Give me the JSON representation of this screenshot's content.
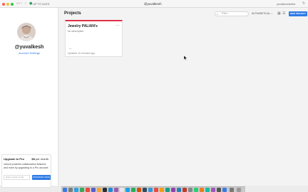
{
  "browser": {
    "tab_label": "UP TO DATE",
    "url": "@yuvalkesh",
    "account_label": "yuvalkesherlier"
  },
  "sidebar": {
    "username": "@yuvalkesh",
    "account_link": "Account Settings"
  },
  "upgrade": {
    "title": "Upgrade to Pro",
    "price": "$8",
    "price_period": "per month",
    "description": "Unlock powerful collaboration features and more by upgrading to a Pro account",
    "input_placeholder": "Enter coupon code",
    "button_label": "UPGRADE ONCE"
  },
  "main": {
    "title": "Projects",
    "filter_placeholder": "Filter...",
    "sort_label": "ALPHABETICAL",
    "new_project_label": "NEW PROJECT"
  },
  "projects": [
    {
      "title": "Jewelry PALIAN's",
      "description": "No description",
      "updated": "Updated 10 minutes ago"
    }
  ],
  "colors": {
    "accent": "#2f7be6",
    "card_stripe": "#e03148"
  },
  "icons": {
    "filter": "search-icon",
    "card_menu": "more-dots-icon",
    "grid_view": "grid-view-icon",
    "list_view": "list-view-icon"
  }
}
